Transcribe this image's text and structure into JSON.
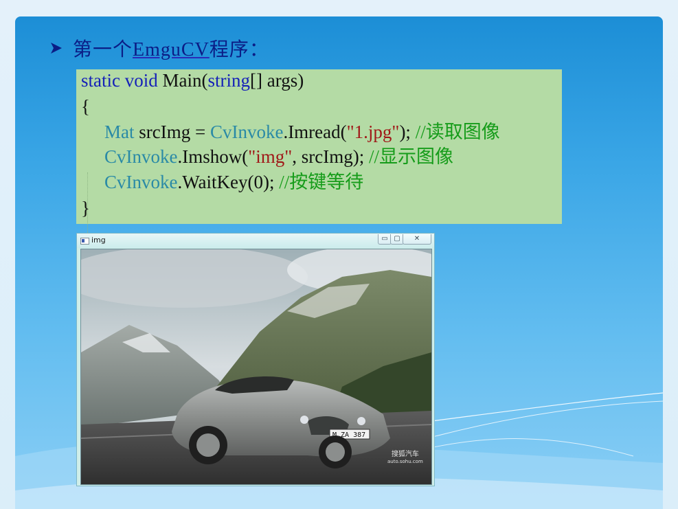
{
  "slide": {
    "title_prefix": "第一个",
    "title_link": "EmguCV",
    "title_suffix": "程序：",
    "colors": {
      "panel_top": "#1c8ed6",
      "panel_bottom": "#8ccff5",
      "title": "#0b1d86",
      "code_bg": "#b4dba5"
    }
  },
  "code": {
    "line1": {
      "kw1": "static",
      "kw2": "void",
      "text1": " Main(",
      "kw3": "string",
      "text2": "[] args)"
    },
    "line2": "{",
    "line3": {
      "type": "Mat",
      "text": " srcImg = ",
      "cls": "CvInvoke",
      "call": ".Imread(",
      "str": "\"1.jpg\"",
      "end": "); ",
      "slashes": "//",
      "comment": "读取图像"
    },
    "line4": {
      "cls": "CvInvoke",
      "call": ".Imshow(",
      "str": "\"img\"",
      "end": ", srcImg); ",
      "slashes": "//",
      "comment": "显示图像"
    },
    "line5": {
      "cls": "CvInvoke",
      "call": ".WaitKey(0); ",
      "slashes": "//",
      "comment": "按键等待"
    },
    "line6": "}"
  },
  "window": {
    "title": "img",
    "buttons": {
      "minimize": "▭",
      "maximize": "▢",
      "close": "✕"
    },
    "plate": "M ZA 387",
    "watermark_cn": "搜狐汽车",
    "watermark_en": "auto.sohu.com"
  }
}
